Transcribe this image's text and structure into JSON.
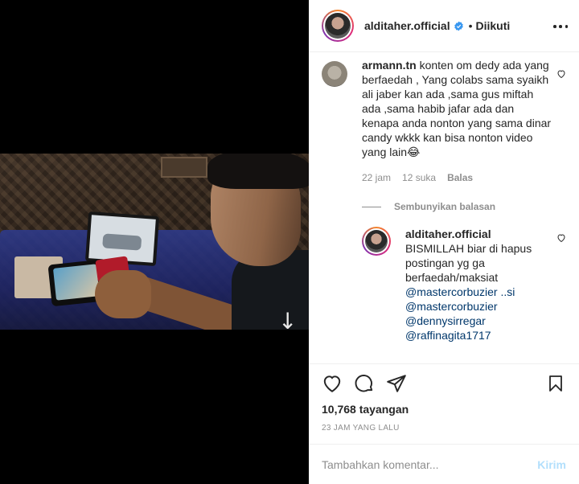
{
  "post": {
    "author": "alditaher.official",
    "follow_dot": "•",
    "follow_state": "Diikuti",
    "views": "10,768 tayangan",
    "time_ago": "23 JAM YANG LALU"
  },
  "comments": [
    {
      "user": "armann.tn",
      "text": "konten om dedy ada yang berfaedah , Yang colabs sama syaikh ali jaber kan ada ,sama gus miftah ada ,sama habib jafar ada dan kenapa anda nonton yang sama dinar candy wkkk kan bisa nonton video yang lain😂",
      "time": "22 jam",
      "likes": "12 suka",
      "reply_label": "Balas",
      "hide_replies": "Sembunyikan balasan",
      "replies": [
        {
          "user": "alditaher.official",
          "text": "BISMILLAH biar di hapus postingan yg ga berfaedah/maksiat",
          "mentions": [
            "@mastercorbuzier ..si",
            "@mastercorbuzier",
            "@dennysirregar",
            "@raffinagita1717"
          ]
        }
      ]
    }
  ],
  "comment_box": {
    "placeholder": "Tambahkan komentar...",
    "post_label": "Kirim"
  },
  "colors": {
    "verified": "#3897f0",
    "link": "#00376b",
    "muted": "#8e8e8e",
    "post_disabled": "#b2dffc"
  },
  "icons": [
    "verified-badge-icon",
    "more-options-icon",
    "heart-icon",
    "comment-icon",
    "share-icon",
    "bookmark-icon"
  ]
}
